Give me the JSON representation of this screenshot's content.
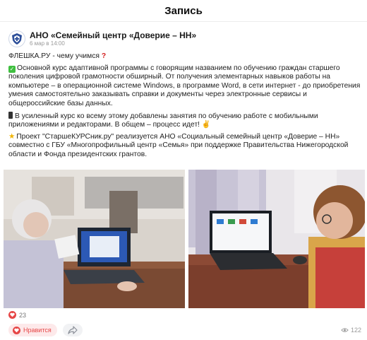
{
  "header": {
    "title": "Запись"
  },
  "author": {
    "name": "АНО «Семейный центр «Доверие – НН»",
    "time": "6 мар в 14:00"
  },
  "post": {
    "line1_text": "ФЛЕШКА.РУ - чему учимся",
    "para2": "Основной курс адаптивной программы с говорящим названием по обучению граждан старшего поколения цифровой грамотности обширный. От получения элементарных навыков работы на компьютере – в операционной системе Windows, в программе Word, в сети интернет - до приобретения умения самостоятельно заказывать справки и документы через электронные сервисы и общероссийские базы данных.",
    "para3": "В усиленный курс ко всему этому добавлены занятия по обучению работе с мобильными приложениями и редакторами. В общем – процесс идет!",
    "para4": "Проект \"СтаршеКУРСник.ру\" реализуется АНО «Социальный семейный центр «Доверие – НН» совместно с ГБУ «Многопрофильный центр «Семья» при поддержке Правительства Нижегородской области и Фонда президентских грантов."
  },
  "reactions": {
    "likes_count": "23"
  },
  "actions": {
    "like_label": "Нравится",
    "views_count": "122"
  },
  "icons": {
    "avatar": "shield-emblem-icon",
    "heart": "heart-icon",
    "share": "share-arrow-icon",
    "views": "eye-icon"
  },
  "colors": {
    "accent_red": "#e64646",
    "like_bg": "#fde9ea"
  }
}
